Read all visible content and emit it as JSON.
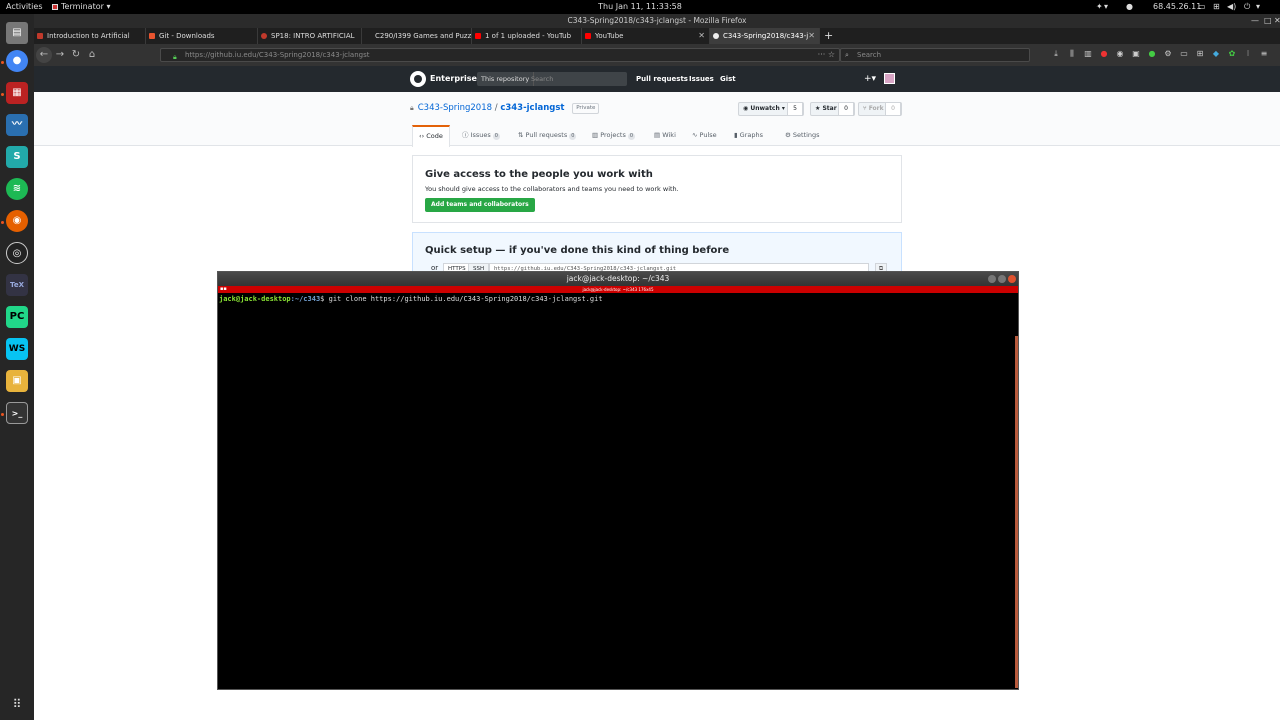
{
  "topbar": {
    "activities": "Activities",
    "app_menu": "Terminator ▾",
    "clock": "Thu Jan 11, 11:33:58",
    "ip": "68.45.26.11"
  },
  "firefox": {
    "window_title": "C343-Spring2018/c343-jclangst - Mozilla Firefox",
    "tabs": [
      {
        "label": "Introduction to Artificial",
        "color": "#c0392b"
      },
      {
        "label": "Git - Downloads",
        "color": "#e8542f"
      },
      {
        "label": "SP18: INTRO ARTIFICIAL",
        "color": "#c0392b"
      },
      {
        "label": "C290/I399 Games and Puzzle",
        "color": "#888888"
      },
      {
        "label": "1 of 1 uploaded - YouTub",
        "color": "#ff0000"
      },
      {
        "label": "YouTube",
        "color": "#ff0000"
      },
      {
        "label": "C343-Spring2018/c343-j",
        "color": "#eeeeee"
      }
    ],
    "url": "https://github.iu.edu/C343-Spring2018/c343-jclangst",
    "search_placeholder": "Search"
  },
  "github": {
    "brand": "Enterprise",
    "search_scope": "This repository",
    "search_placeholder": "Search",
    "nav": [
      "Pull requests",
      "Issues",
      "Gist"
    ],
    "owner": "C343-Spring2018",
    "separator": "/",
    "repo": "c343-jclangst",
    "private_label": "Private",
    "watch_label": "Unwatch ▾",
    "watch_count": "5",
    "star_label": "Star",
    "star_count": "0",
    "fork_label": "Fork",
    "fork_count": "0",
    "repo_tabs": {
      "code": "Code",
      "issues": "Issues",
      "issues_count": "0",
      "pulls": "Pull requests",
      "pulls_count": "0",
      "projects": "Projects",
      "projects_count": "0",
      "wiki": "Wiki",
      "pulse": "Pulse",
      "graphs": "Graphs",
      "settings": "Settings"
    },
    "access_title": "Give access to the people you work with",
    "access_text": "You should give access to the collaborators and teams you need to work with.",
    "access_button": "Add teams and collaborators",
    "setup_title": "Quick setup — if you've done this kind of thing before",
    "setup_or": "or",
    "setup_https": "HTTPS",
    "setup_ssh": "SSH",
    "setup_url": "https://github.iu.edu/C343-Spring2018/c343-jclangst.git"
  },
  "terminal": {
    "title": "jack@jack-desktop: ~/c343",
    "pane_title": "jack@jack-desktop: ~/c343 176x45",
    "prompt_user": "jack@jack-desktop",
    "prompt_path": ":~/c343",
    "prompt_symbol": "$ ",
    "command": "git clone https://github.iu.edu/C343-Spring2018/c343-jclangst.git"
  }
}
